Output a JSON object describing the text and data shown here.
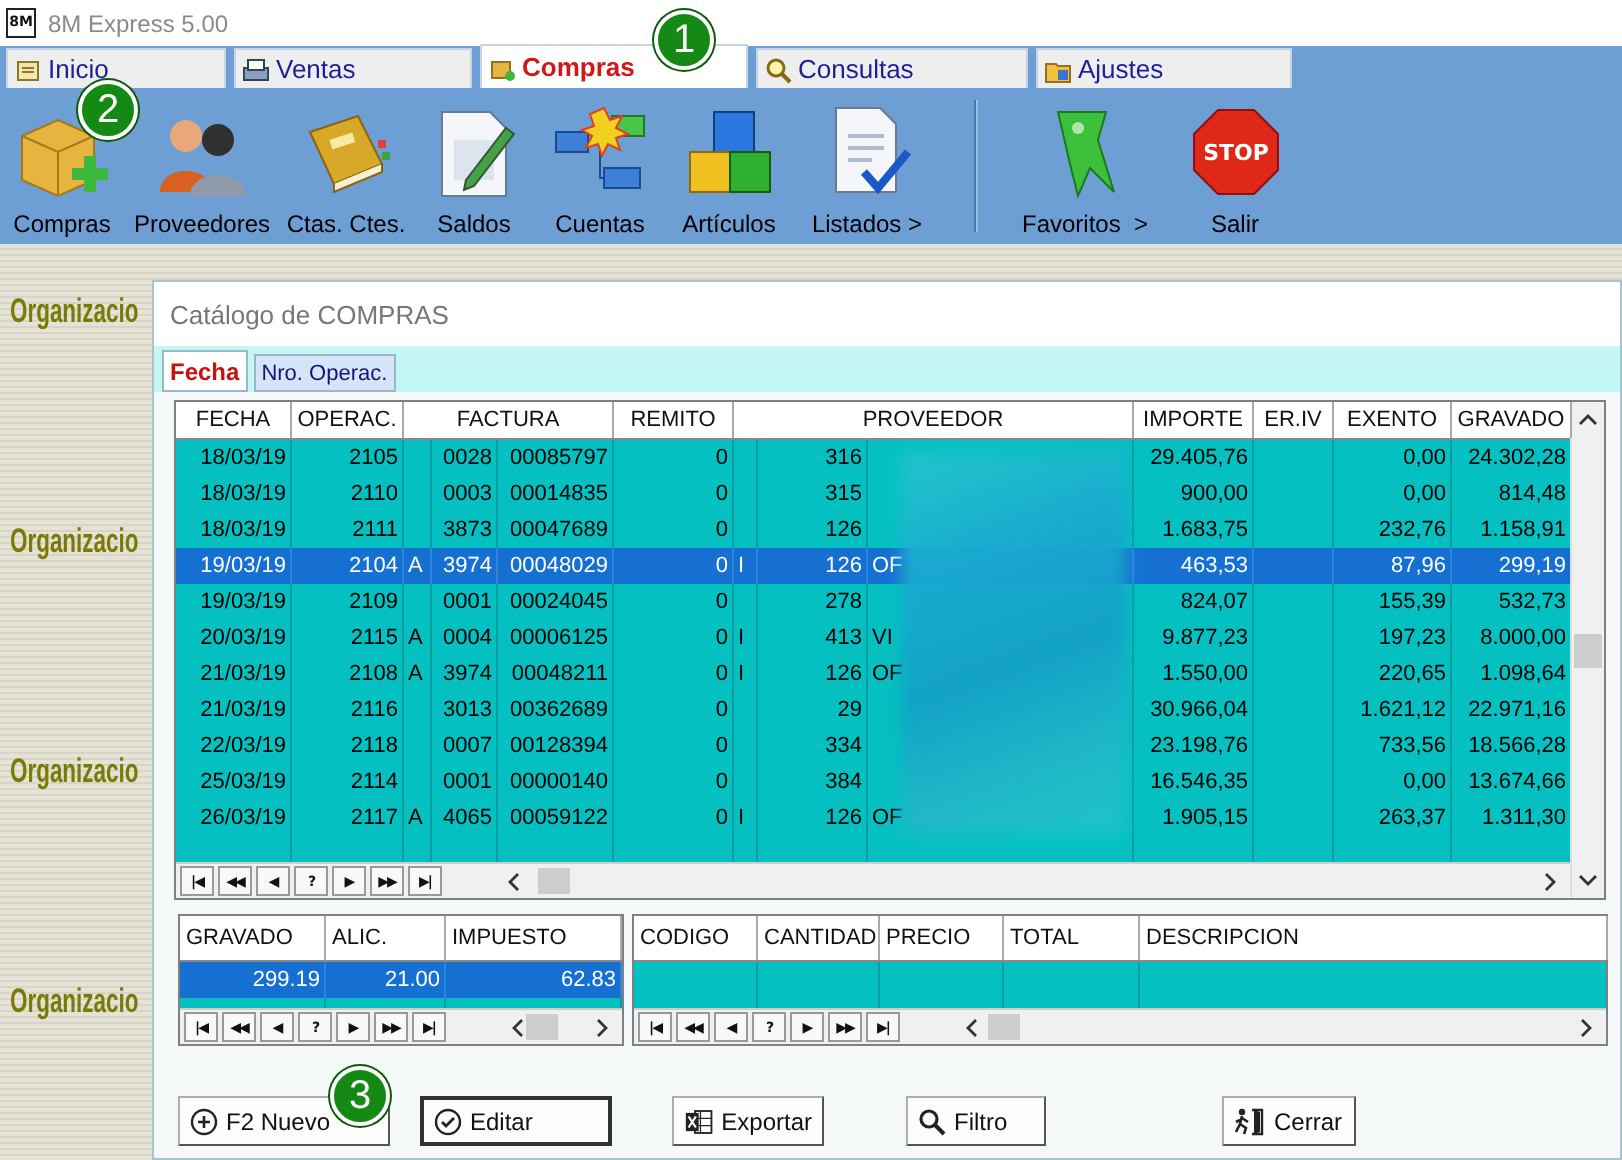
{
  "window": {
    "logo": "8M",
    "title": "8M Express 5.00"
  },
  "tabs": [
    {
      "label": "Inicio",
      "selected": false
    },
    {
      "label": "Ventas",
      "selected": false
    },
    {
      "label": "Compras",
      "selected": true
    },
    {
      "label": "Consultas",
      "selected": false
    },
    {
      "label": "Ajustes",
      "selected": false
    }
  ],
  "toolbar": {
    "groups": [
      [
        {
          "label": "Compras"
        },
        {
          "label": "Proveedores"
        },
        {
          "label": "Ctas. Ctes."
        },
        {
          "label": "Saldos"
        },
        {
          "label": "Cuentas"
        },
        {
          "label": "Artículos"
        },
        {
          "label": "Listados >"
        }
      ],
      [
        {
          "label": "Favoritos  >"
        },
        {
          "label": "Salir",
          "sign": "STOP"
        }
      ]
    ]
  },
  "background": {
    "labels": [
      "Organizacio",
      "Organizacio",
      "Organizacio",
      "Organizacio"
    ]
  },
  "callouts": [
    "1",
    "2",
    "3"
  ],
  "dialog": {
    "title": "Catálogo de COMPRAS",
    "tabs": [
      {
        "label": "Fecha",
        "selected": true
      },
      {
        "label": "Nro. Operac.",
        "selected": false
      }
    ],
    "grid": {
      "columns": [
        "FECHA",
        "OPERAC.",
        "FACTURA",
        "REMITO",
        "PROVEEDOR",
        "IMPORTE",
        "ER.IV",
        "EXENTO",
        "GRAVADO"
      ],
      "rows": [
        {
          "fecha": "18/03/19",
          "operac": "2105",
          "punto": "0028",
          "numero": "00085797",
          "remito": "0",
          "prov_code": "316",
          "importe": "29.405,76",
          "exento": "0,00",
          "gravado": "24.302,28",
          "selected": false
        },
        {
          "fecha": "18/03/19",
          "operac": "2110",
          "punto": "0003",
          "numero": "00014835",
          "remito": "0",
          "prov_code": "315",
          "importe": "900,00",
          "exento": "0,00",
          "gravado": "814,48",
          "selected": false
        },
        {
          "fecha": "18/03/19",
          "operac": "2111",
          "punto": "3873",
          "numero": "00047689",
          "remito": "0",
          "prov_code": "126",
          "importe": "1.683,75",
          "exento": "232,76",
          "gravado": "1.158,91",
          "selected": false
        },
        {
          "fecha": "19/03/19",
          "operac": "2104",
          "letra": "A",
          "punto": "3974",
          "numero": "00048029",
          "remito": "0",
          "flag": "I",
          "prov_code": "126",
          "prov_name": "OF",
          "importe": "463,53",
          "exento": "87,96",
          "gravado": "299,19",
          "selected": true
        },
        {
          "fecha": "19/03/19",
          "operac": "2109",
          "punto": "0001",
          "numero": "00024045",
          "remito": "0",
          "prov_code": "278",
          "importe": "824,07",
          "exento": "155,39",
          "gravado": "532,73",
          "selected": false
        },
        {
          "fecha": "20/03/19",
          "operac": "2115",
          "letra": "A",
          "punto": "0004",
          "numero": "00006125",
          "remito": "0",
          "flag": "I",
          "prov_code": "413",
          "prov_name": "VI",
          "importe": "9.877,23",
          "exento": "197,23",
          "gravado": "8.000,00",
          "selected": false
        },
        {
          "fecha": "21/03/19",
          "operac": "2108",
          "letra": "A",
          "punto": "3974",
          "numero": "00048211",
          "remito": "0",
          "flag": "I",
          "prov_code": "126",
          "prov_name": "OF",
          "importe": "1.550,00",
          "exento": "220,65",
          "gravado": "1.098,64",
          "selected": false
        },
        {
          "fecha": "21/03/19",
          "operac": "2116",
          "punto": "3013",
          "numero": "00362689",
          "remito": "0",
          "prov_code": "29",
          "importe": "30.966,04",
          "exento": "1.621,12",
          "gravado": "22.971,16",
          "selected": false
        },
        {
          "fecha": "22/03/19",
          "operac": "2118",
          "punto": "0007",
          "numero": "00128394",
          "remito": "0",
          "prov_code": "334",
          "importe": "23.198,76",
          "exento": "733,56",
          "gravado": "18.566,28",
          "selected": false
        },
        {
          "fecha": "25/03/19",
          "operac": "2114",
          "punto": "0001",
          "numero": "00000140",
          "remito": "0",
          "prov_code": "384",
          "importe": "16.546,35",
          "exento": "0,00",
          "gravado": "13.674,66",
          "selected": false
        },
        {
          "fecha": "26/03/19",
          "operac": "2117",
          "letra": "A",
          "punto": "4065",
          "numero": "00059122",
          "remito": "0",
          "flag": "I",
          "prov_code": "126",
          "prov_name": "OF",
          "importe": "1.905,15",
          "exento": "263,37",
          "gravado": "1.311,30",
          "selected": false
        }
      ],
      "nav": [
        "|◀",
        "◀◀",
        "◀",
        "?",
        "▶",
        "▶▶",
        "▶|"
      ]
    },
    "tax_grid": {
      "columns": [
        "GRAVADO",
        "ALIC.",
        "IMPUESTO"
      ],
      "rows": [
        {
          "cells": [
            "299.19",
            "21.00",
            "62.83"
          ],
          "selected": true
        }
      ],
      "nav": [
        "|◀",
        "◀◀",
        "◀",
        "?",
        "▶",
        "▶▶",
        "▶|"
      ]
    },
    "items_grid": {
      "columns": [
        "CODIGO",
        "CANTIDAD",
        "PRECIO",
        "TOTAL",
        "DESCRIPCION"
      ],
      "nav": [
        "|◀",
        "◀◀",
        "◀",
        "?",
        "▶",
        "▶▶",
        "▶|"
      ]
    },
    "buttons": [
      {
        "label": "F2 Nuevo",
        "default": false
      },
      {
        "label": "Editar",
        "default": true
      },
      {
        "label": "Exportar",
        "default": false
      },
      {
        "label": "Filtro",
        "default": false
      },
      {
        "label": "Cerrar",
        "default": false
      }
    ]
  }
}
